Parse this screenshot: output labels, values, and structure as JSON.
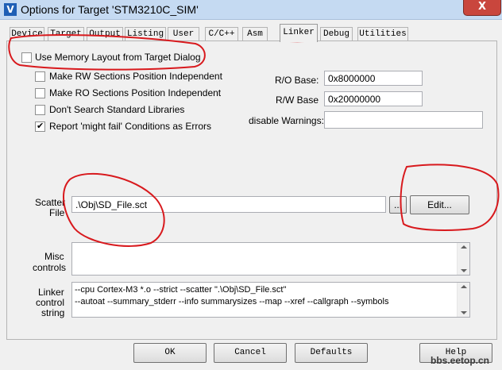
{
  "window": {
    "title": "Options for Target 'STM3210C_SIM'",
    "close_label": "X",
    "app_icon_glyph": "V"
  },
  "tabs": [
    {
      "label": "Device"
    },
    {
      "label": "Target"
    },
    {
      "label": "Output"
    },
    {
      "label": "Listing"
    },
    {
      "label": "User"
    },
    {
      "label": "C/C++"
    },
    {
      "label": "Asm"
    },
    {
      "label": "Linker"
    },
    {
      "label": "Debug"
    },
    {
      "label": "Utilities"
    }
  ],
  "active_tab": "Linker",
  "options": {
    "use_memory_layout": {
      "label": "Use Memory Layout from Target Dialog",
      "checked": false
    },
    "rw_independent": {
      "label": "Make RW Sections Position Independent",
      "checked": false
    },
    "ro_independent": {
      "label": "Make RO Sections Position Independent",
      "checked": false
    },
    "dont_search_std": {
      "label": "Don't Search Standard Libraries",
      "checked": false
    },
    "report_might_fail": {
      "label": "Report 'might fail' Conditions as Errors",
      "checked": true
    }
  },
  "bases": {
    "ro_label": "R/O Base:",
    "ro_value": "0x8000000",
    "rw_label": "R/W Base",
    "rw_value": "0x20000000",
    "warnings_label": "disable Warnings:",
    "warnings_value": ""
  },
  "scatter": {
    "label_line1": "Scatter",
    "label_line2": "File",
    "value": ".\\Obj\\SD_File.sct",
    "browse_label": "...",
    "edit_label": "Edit..."
  },
  "misc": {
    "label_line1": "Misc",
    "label_line2": "controls",
    "value": ""
  },
  "linker_string": {
    "label_line1": "Linker",
    "label_line2": "control",
    "label_line3": "string",
    "line1": "--cpu Cortex-M3 *.o --strict --scatter \".\\Obj\\SD_File.sct\"",
    "line2": "--autoat --summary_stderr --info summarysizes --map --xref --callgraph --symbols"
  },
  "buttons": {
    "ok": "OK",
    "cancel": "Cancel",
    "defaults": "Defaults",
    "help": "Help"
  },
  "watermark": "bbs.eetop.cn",
  "annotation_color": "#d8191d"
}
